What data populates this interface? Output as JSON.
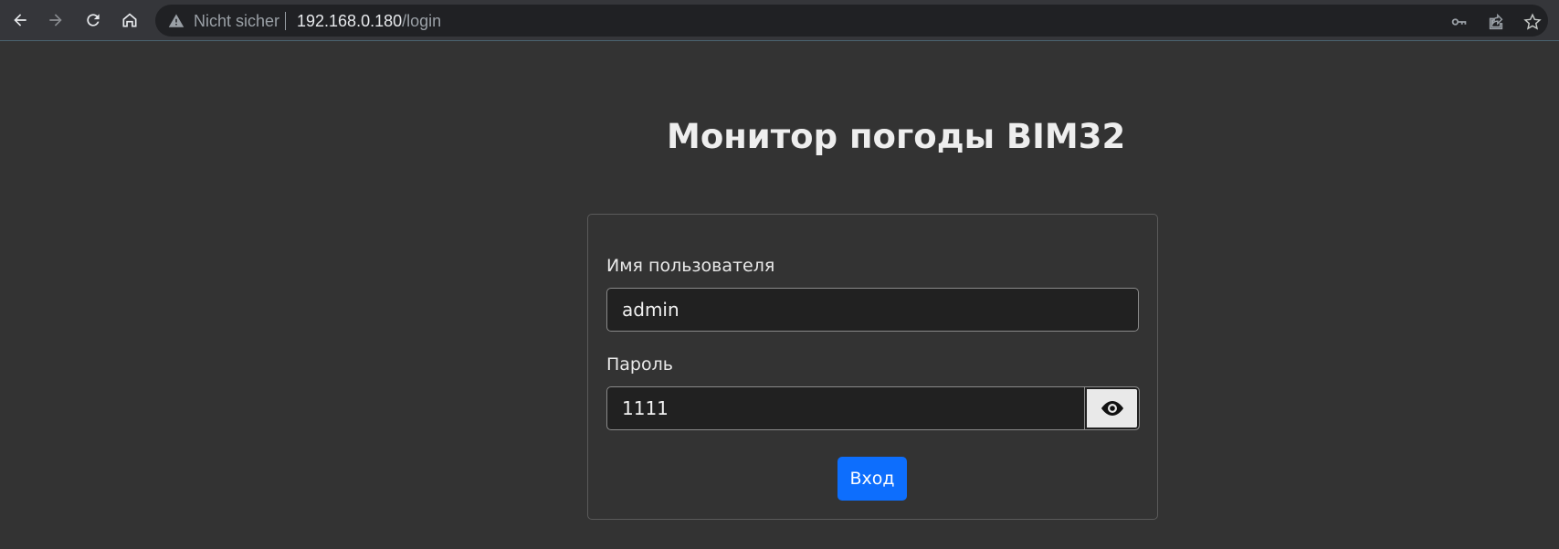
{
  "browser": {
    "security_status": "Nicht sicher",
    "url_host": "192.168.0.180",
    "url_path": "/login"
  },
  "page": {
    "title": "Монитор погоды BIM32"
  },
  "form": {
    "username_label": "Имя пользователя",
    "username_value": "admin",
    "password_label": "Пароль",
    "password_value": "1111",
    "submit_label": "Вход"
  },
  "colors": {
    "background": "#333333",
    "input_background": "#212121",
    "primary_button": "#0d6efd"
  },
  "icons": [
    "back-icon",
    "forward-icon",
    "reload-icon",
    "home-icon",
    "warning-icon",
    "key-icon",
    "share-icon",
    "star-icon",
    "eye-icon"
  ]
}
